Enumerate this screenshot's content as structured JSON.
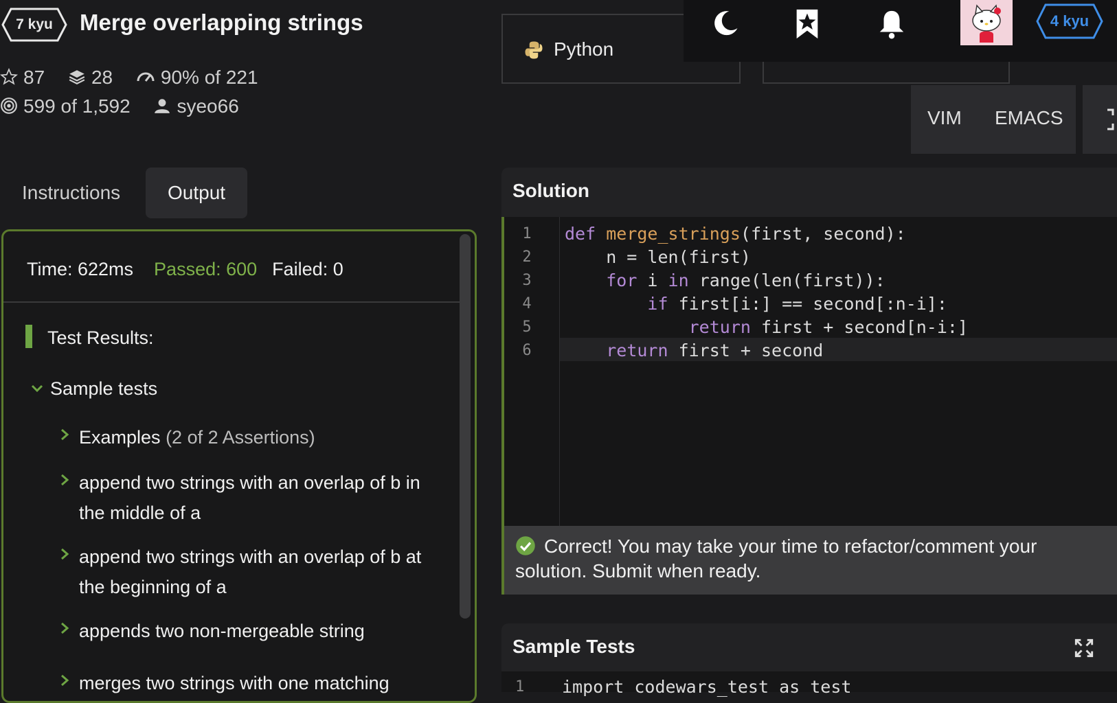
{
  "kata": {
    "rank": "7 kyu",
    "title": "Merge overlapping strings",
    "stats": {
      "stars": "87",
      "collections": "28",
      "satisfaction": "90% of 221",
      "completed": "599 of 1,592",
      "author": "syeo66"
    }
  },
  "tabs": [
    {
      "label": "Instructions",
      "active": false
    },
    {
      "label": "Output",
      "active": true
    }
  ],
  "output": {
    "time": "Time: 622ms",
    "passed": "Passed: 600",
    "failed": "Failed: 0",
    "results_heading": "Test Results:",
    "group": "Sample tests",
    "items": [
      {
        "text": "Examples",
        "count": "(2 of 2 Assertions)"
      },
      {
        "text": "append two strings with an overlap of b in the middle of a"
      },
      {
        "text": "append two strings with an overlap of b at the beginning of a"
      },
      {
        "text": "appends two non-mergeable string"
      },
      {
        "text": "merges two strings with one matching"
      }
    ]
  },
  "editor": {
    "language": "Python",
    "modes": [
      "VIM",
      "EMACS"
    ],
    "solution_title": "Solution",
    "line_numbers": [
      "1",
      "2",
      "3",
      "4",
      "5",
      "6"
    ],
    "success_message": "Correct! You may take your time to refactor/comment your solution. Submit when ready.",
    "sample_tests_title": "Sample Tests",
    "sample_line_number": "1",
    "sample_code": "import codewars_test as test"
  },
  "user": {
    "rank": "4 kyu"
  },
  "icons": [
    "moon-icon",
    "bookmark-icon",
    "bell-icon",
    "avatar",
    "star-icon",
    "layers-icon",
    "gauge-icon",
    "target-icon",
    "user-icon",
    "python-icon",
    "check-circle-icon",
    "expand-icon"
  ],
  "colors": {
    "accent_green": "#6ea544",
    "rank_blue": "#3f8ee8",
    "keyword": "#b48ad6",
    "function": "#d9a05a"
  }
}
